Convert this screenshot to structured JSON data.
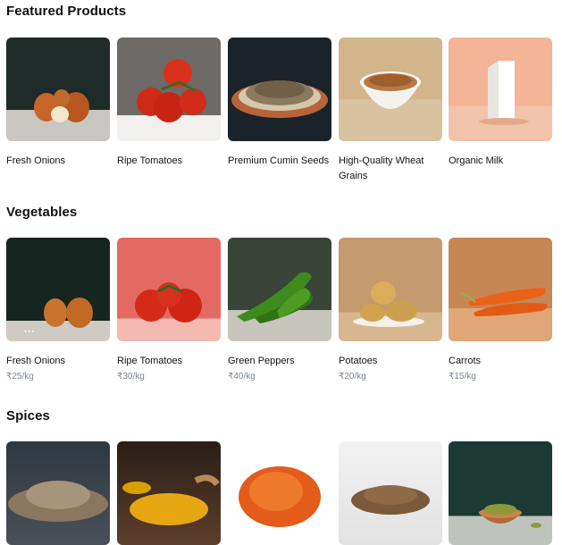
{
  "sections": {
    "featured": {
      "title": "Featured Products",
      "items": [
        {
          "name": "Fresh Onions"
        },
        {
          "name": "Ripe Tomatoes"
        },
        {
          "name": "Premium Cumin Seeds"
        },
        {
          "name": "High-Quality Wheat Grains"
        },
        {
          "name": "Organic Milk"
        }
      ]
    },
    "vegetables": {
      "title": "Vegetables",
      "items": [
        {
          "name": "Fresh Onions",
          "price": "₹25/kg"
        },
        {
          "name": "Ripe Tomatoes",
          "price": "₹30/kg"
        },
        {
          "name": "Green Peppers",
          "price": "₹40/kg"
        },
        {
          "name": "Potatoes",
          "price": "₹20/kg"
        },
        {
          "name": "Carrots",
          "price": "₹15/kg"
        }
      ]
    },
    "spices": {
      "title": "Spices",
      "items": [
        {
          "image": "cumin-pile-image"
        },
        {
          "image": "turmeric-image"
        },
        {
          "image": "chili-powder-image"
        },
        {
          "image": "coriander-seeds-image"
        },
        {
          "image": "cardamom-bowl-image"
        }
      ]
    }
  }
}
